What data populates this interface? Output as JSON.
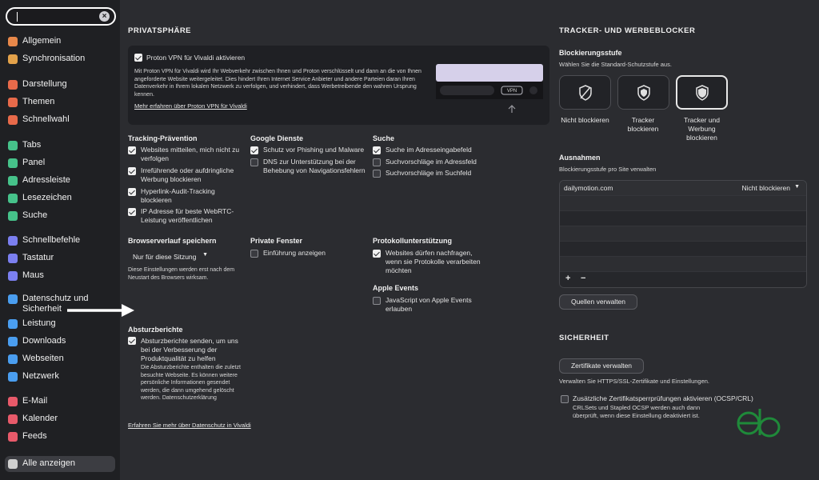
{
  "sidebar": {
    "search_placeholder": "",
    "items": [
      {
        "label": "Allgemein",
        "icon": "gear-icon",
        "color": "#e8884a"
      },
      {
        "label": "Synchronisation",
        "icon": "cloud-icon",
        "color": "#e3a24a"
      },
      {
        "label": "Darstellung",
        "icon": "appearance-icon",
        "color": "#e86a4a"
      },
      {
        "label": "Themen",
        "icon": "brush-icon",
        "color": "#e86a4a"
      },
      {
        "label": "Schnellwahl",
        "icon": "grid-icon",
        "color": "#e86a4a"
      },
      {
        "label": "Tabs",
        "icon": "tabs-icon",
        "color": "#46c28a"
      },
      {
        "label": "Panel",
        "icon": "panel-icon",
        "color": "#46c28a"
      },
      {
        "label": "Adressleiste",
        "icon": "address-bar-icon",
        "color": "#46c28a"
      },
      {
        "label": "Lesezeichen",
        "icon": "bookmark-icon",
        "color": "#46c28a"
      },
      {
        "label": "Suche",
        "icon": "search-icon",
        "color": "#46c28a"
      },
      {
        "label": "Schnellbefehle",
        "icon": "command-icon",
        "color": "#7b7ff0"
      },
      {
        "label": "Tastatur",
        "icon": "keyboard-icon",
        "color": "#7b7ff0"
      },
      {
        "label": "Maus",
        "icon": "mouse-icon",
        "color": "#7b7ff0"
      },
      {
        "label": "Datenschutz und Sicherheit",
        "icon": "shield-icon",
        "color": "#4a9ef0"
      },
      {
        "label": "Leistung",
        "icon": "gauge-icon",
        "color": "#4a9ef0"
      },
      {
        "label": "Downloads",
        "icon": "download-icon",
        "color": "#4a9ef0"
      },
      {
        "label": "Webseiten",
        "icon": "globe-icon",
        "color": "#4a9ef0"
      },
      {
        "label": "Netzwerk",
        "icon": "network-icon",
        "color": "#4a9ef0"
      },
      {
        "label": "E-Mail",
        "icon": "mail-icon",
        "color": "#e85a6a"
      },
      {
        "label": "Kalender",
        "icon": "calendar-icon",
        "color": "#e85a6a"
      },
      {
        "label": "Feeds",
        "icon": "feed-icon",
        "color": "#e85a6a"
      },
      {
        "label": "Alle anzeigen",
        "icon": "settings-all-icon",
        "color": "#d0d0d0"
      }
    ]
  },
  "privacy": {
    "title": "PRIVATSPHÄRE",
    "vpn": {
      "checkbox_label": "Proton VPN für Vivaldi aktivieren",
      "description": "Mit Proton VPN für Vivaldi wird Ihr Webverkehr zwischen Ihnen und Proton verschlüsselt und dann an die von Ihnen angeforderte Website weitergeleitet. Dies hindert Ihren Internet Service Anbieter und andere Parteien daran Ihren Datenverkehr in Ihrem lokalen Netzwerk zu verfolgen, und verhindert, dass Werbetreibende den wahren Ursprung kennen.",
      "link": "Mehr erfahren über Proton VPN für Vivaldi",
      "preview_badge": "VPN"
    },
    "tracking": {
      "title": "Tracking-Prävention",
      "items": [
        {
          "label": "Websites mitteilen, mich nicht zu verfolgen",
          "checked": true
        },
        {
          "label": "Irreführende oder aufdringliche Werbung blockieren",
          "checked": true
        },
        {
          "label": "Hyperlink-Audit-Tracking blockieren",
          "checked": true
        },
        {
          "label": "IP Adresse für beste WebRTC-Leistung veröffentlichen",
          "checked": true
        }
      ]
    },
    "google": {
      "title": "Google Dienste",
      "items": [
        {
          "label": "Schutz vor Phishing und Malware",
          "checked": true
        },
        {
          "label": "DNS zur Unterstützung bei der Behebung von Navigationsfehlern",
          "checked": false
        }
      ]
    },
    "search": {
      "title": "Suche",
      "items": [
        {
          "label": "Suche im Adresseingabefeld",
          "checked": true
        },
        {
          "label": "Suchvorschläge im Adressfeld",
          "checked": false
        },
        {
          "label": "Suchvorschläge im Suchfeld",
          "checked": false
        }
      ]
    },
    "history": {
      "title": "Browserverlauf speichern",
      "selected": "Nur für diese Sitzung",
      "note": "Diese Einstellungen werden erst nach dem Neustart des Browsers wirksam."
    },
    "private_window": {
      "title": "Private Fenster",
      "items": [
        {
          "label": "Einführung anzeigen",
          "checked": false
        }
      ]
    },
    "protocol": {
      "title": "Protokollunterstützung",
      "items": [
        {
          "label": "Websites dürfen nachfragen, wenn sie Protokolle verarbeiten möchten",
          "checked": true
        }
      ]
    },
    "apple": {
      "title": "Apple Events",
      "items": [
        {
          "label": "JavaScript von Apple Events erlauben",
          "checked": false
        }
      ]
    },
    "crash": {
      "title": "Absturzberichte",
      "checkbox_label": "Absturzberichte senden, um uns bei der Verbesserung der Produktqualität zu helfen",
      "checked": true,
      "note": "Die Absturzberichte enthalten die zuletzt besuchte Webseite. Es können weitere persönliche Informationen gesendet werden, die dann umgehend gelöscht werden. Datenschutzerklärung"
    },
    "more_link": "Erfahren Sie mehr über Datenschutz in Vivaldi"
  },
  "blocker": {
    "title": "TRACKER- UND WERBEBLOCKER",
    "level_title": "Blockierungsstufe",
    "level_desc": "Wählen Sie die Standard-Schutzstufe aus.",
    "levels": [
      {
        "label": "Nicht blockieren",
        "selected": false
      },
      {
        "label": "Tracker blockieren",
        "selected": false
      },
      {
        "label": "Tracker und Werbung blockieren",
        "selected": true
      }
    ],
    "exceptions_title": "Ausnahmen",
    "exceptions_desc": "Blockierungsstufe pro Site verwalten",
    "exceptions": [
      {
        "site": "dailymotion.com",
        "level": "Nicht blockieren"
      }
    ],
    "add_label": "+",
    "remove_label": "−",
    "sources_button": "Quellen verwalten"
  },
  "security": {
    "title": "SICHERHEIT",
    "cert_button": "Zertifikate verwalten",
    "cert_desc": "Verwalten Sie HTTPS/SSL-Zertifikate und Einstellungen.",
    "ocsp_label": "Zusätzliche Zertifikatsperrprüfungen aktivieren (OCSP/CRL)",
    "ocsp_checked": false,
    "ocsp_desc": "CRLSets und Stapled OCSP werden auch dann überprüft, wenn diese Einstellung deaktiviert ist."
  },
  "colors": {
    "accent": "#ffffff",
    "watermark": "#1f8a3a"
  }
}
